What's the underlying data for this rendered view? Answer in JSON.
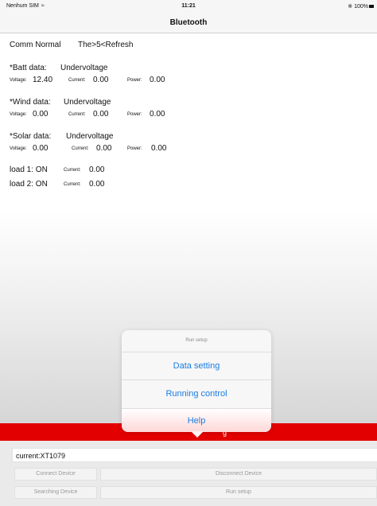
{
  "status_bar": {
    "carrier": "Nenhum SIM",
    "time": "11:21",
    "battery": "100%"
  },
  "nav": {
    "title": "Bluetooth"
  },
  "comm": {
    "status": "Comm Normal",
    "refresh": "The>5<Refresh"
  },
  "batt": {
    "label": "*Batt data:",
    "state": "Undervoltage",
    "voltage_label": "Voltage:",
    "voltage": "12.40",
    "current_label": "Current:",
    "current": "0.00",
    "power_label": "Power:",
    "power": "0.00"
  },
  "wind": {
    "label": "*Wind data:",
    "state": "Undervoltage",
    "voltage_label": "Voltage:",
    "voltage": "0.00",
    "current_label": "Current:",
    "current": "0.00",
    "power_label": "Power:",
    "power": "0.00"
  },
  "solar": {
    "label": "*Solar data:",
    "state": "Undervoltage",
    "voltage_label": "Voltage:",
    "voltage": "0.00",
    "current_label": "Current:",
    "current": "0.00",
    "power_label": "Power:",
    "power": "0.00"
  },
  "load1": {
    "label": "load 1: ON",
    "current_label": "Current:",
    "current": "0.00"
  },
  "load2": {
    "label": "load 2: ON",
    "current_label": "Current:",
    "current": "0.00"
  },
  "redbar": {
    "text": "g"
  },
  "device": {
    "current": "current:XT1079"
  },
  "buttons": {
    "connect": "Connect Device",
    "disconnect": "Disconnect Device",
    "searching": "Searching Device",
    "run_setup": "Run setup"
  },
  "popover": {
    "title": "Run setup",
    "items": [
      "Data setting",
      "Running control",
      "Help"
    ]
  },
  "colors": {
    "accent": "#1a7de2",
    "redbar": "#e30000"
  }
}
